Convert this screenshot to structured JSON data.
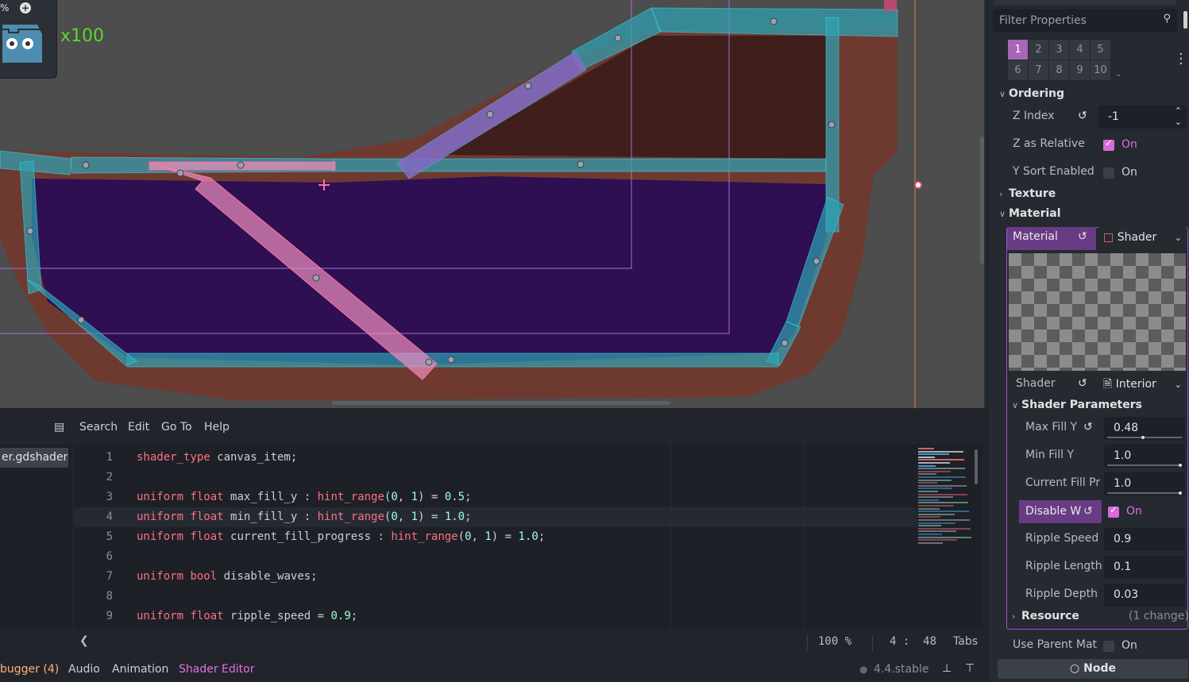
{
  "viewport": {
    "zoom_percent": "%",
    "zoom_add": "+",
    "multiplier": "x100"
  },
  "inspector": {
    "filter_placeholder": "Filter Properties",
    "search_icon": "search-icon",
    "layers": [
      "1",
      "2",
      "3",
      "4",
      "5",
      "6",
      "7",
      "8",
      "9",
      "10"
    ],
    "active_layer": "1",
    "ordering": {
      "title": "Ordering",
      "z_index_label": "Z Index",
      "z_index_value": "-1",
      "z_relative_label": "Z as Relative",
      "z_relative_value": "On",
      "y_sort_label": "Y Sort Enabled",
      "y_sort_value": "On"
    },
    "texture_title": "Texture",
    "material_title": "Material",
    "material": {
      "label": "Material",
      "resource": "Shader",
      "shader_label": "Shader",
      "shader_resource": "Interior"
    },
    "shader_params": {
      "title": "Shader Parameters",
      "max_fill_label": "Max Fill Y",
      "max_fill_value": "0.48",
      "max_fill_level": 0.48,
      "min_fill_label": "Min Fill Y",
      "min_fill_value": "1.0",
      "min_fill_level": 1.0,
      "current_fill_label": "Current Fill Pr",
      "current_fill_value": "1.0",
      "current_fill_level": 1.0,
      "disable_label": "Disable W",
      "disable_value": "On",
      "ripple_speed_label": "Ripple Speed",
      "ripple_speed_value": "0.9",
      "ripple_length_label": "Ripple Length",
      "ripple_length_value": "0.1",
      "ripple_depth_label": "Ripple Depth",
      "ripple_depth_value": "0.03"
    },
    "resource_title": "Resource",
    "resource_changes": "(1 change)",
    "use_parent_label": "Use Parent Mat",
    "use_parent_value": "On",
    "node_tab": "Node"
  },
  "editor": {
    "menu": [
      "Search",
      "Edit",
      "Go To",
      "Help"
    ],
    "file": "er.gdshader",
    "lines": [
      {
        "n": "1",
        "tokens": [
          [
            "kw",
            "shader_type"
          ],
          [
            "id",
            " canvas_item;"
          ]
        ]
      },
      {
        "n": "2",
        "tokens": []
      },
      {
        "n": "3",
        "tokens": [
          [
            "kw",
            "uniform"
          ],
          [
            "id",
            " "
          ],
          [
            "kw",
            "float"
          ],
          [
            "id",
            " max_fill_y : "
          ],
          [
            "kw",
            "hint_range"
          ],
          [
            "id",
            "("
          ],
          [
            "num",
            "0"
          ],
          [
            "id",
            ", "
          ],
          [
            "num",
            "1"
          ],
          [
            "id",
            ") = "
          ],
          [
            "num",
            "0.5"
          ],
          [
            "id",
            ";"
          ]
        ]
      },
      {
        "n": "4",
        "tokens": [
          [
            "kw",
            "uniform"
          ],
          [
            "id",
            " "
          ],
          [
            "kw",
            "float"
          ],
          [
            "id",
            " min_fill_y : "
          ],
          [
            "kw",
            "hint_range"
          ],
          [
            "id",
            "("
          ],
          [
            "num",
            "0"
          ],
          [
            "id",
            ", "
          ],
          [
            "num",
            "1"
          ],
          [
            "id",
            ") = "
          ],
          [
            "num",
            "1.0"
          ],
          [
            "id",
            ";"
          ]
        ]
      },
      {
        "n": "5",
        "tokens": [
          [
            "kw",
            "uniform"
          ],
          [
            "id",
            " "
          ],
          [
            "kw",
            "float"
          ],
          [
            "id",
            " current_fill_progress : "
          ],
          [
            "kw",
            "hint_range"
          ],
          [
            "id",
            "("
          ],
          [
            "num",
            "0"
          ],
          [
            "id",
            ", "
          ],
          [
            "num",
            "1"
          ],
          [
            "id",
            ") = "
          ],
          [
            "num",
            "1.0"
          ],
          [
            "id",
            ";"
          ]
        ]
      },
      {
        "n": "6",
        "tokens": []
      },
      {
        "n": "7",
        "tokens": [
          [
            "kw",
            "uniform"
          ],
          [
            "id",
            " "
          ],
          [
            "kw",
            "bool"
          ],
          [
            "id",
            " disable_waves;"
          ]
        ]
      },
      {
        "n": "8",
        "tokens": []
      },
      {
        "n": "9",
        "tokens": [
          [
            "kw",
            "uniform"
          ],
          [
            "id",
            " "
          ],
          [
            "kw",
            "float"
          ],
          [
            "id",
            " ripple_speed = "
          ],
          [
            "num",
            "0.9"
          ],
          [
            "id",
            ";"
          ]
        ]
      }
    ],
    "current_line": "4",
    "zoom": "100 %",
    "line_col": "4 :  48",
    "indent": "Tabs",
    "back_icon": "chevron-left-icon"
  },
  "bottom_tabs": {
    "debugger": "bugger (4)",
    "audio": "Audio",
    "animation": "Animation",
    "shader_editor": "Shader Editor",
    "version": "4.4.stable"
  },
  "colors": {
    "accent": "#e070e0",
    "cyan_polygon": "#2d8a9a",
    "pink_polygon": "#f08fbf",
    "purple_fill": "#2e0f52",
    "brown_shape": "#6e3a30"
  }
}
